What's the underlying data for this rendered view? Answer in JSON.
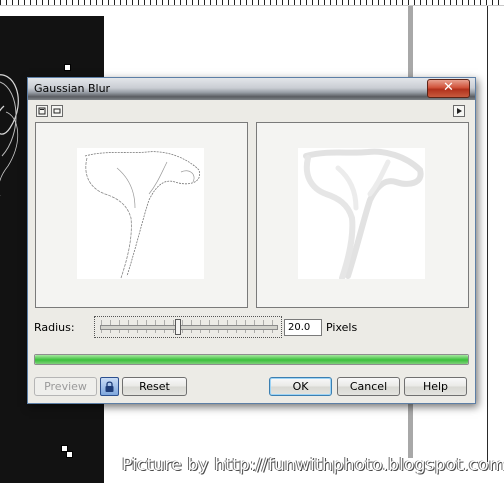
{
  "dialog": {
    "title": "Gaussian Blur",
    "close_glyph": "✕",
    "radius_label": "Radius:",
    "radius_value": "20.0",
    "units_label": "Pixels",
    "progress_fraction": 1.0,
    "buttons": {
      "preview": "Preview",
      "reset": "Reset",
      "ok": "OK",
      "cancel": "Cancel",
      "help": "Help"
    },
    "icons": {
      "view_original": "window-icon",
      "view_preview": "window-single-icon",
      "options": "play-arrow-icon",
      "lock": "lock-icon"
    }
  },
  "watermark": "Picture by http://funwithphoto.blogspot.com/",
  "colors": {
    "title_gradient_dark": "#5a5d62",
    "close_red": "#c8452c",
    "progress_green": "#3bbf3b",
    "canvas_dark": "#121212"
  }
}
